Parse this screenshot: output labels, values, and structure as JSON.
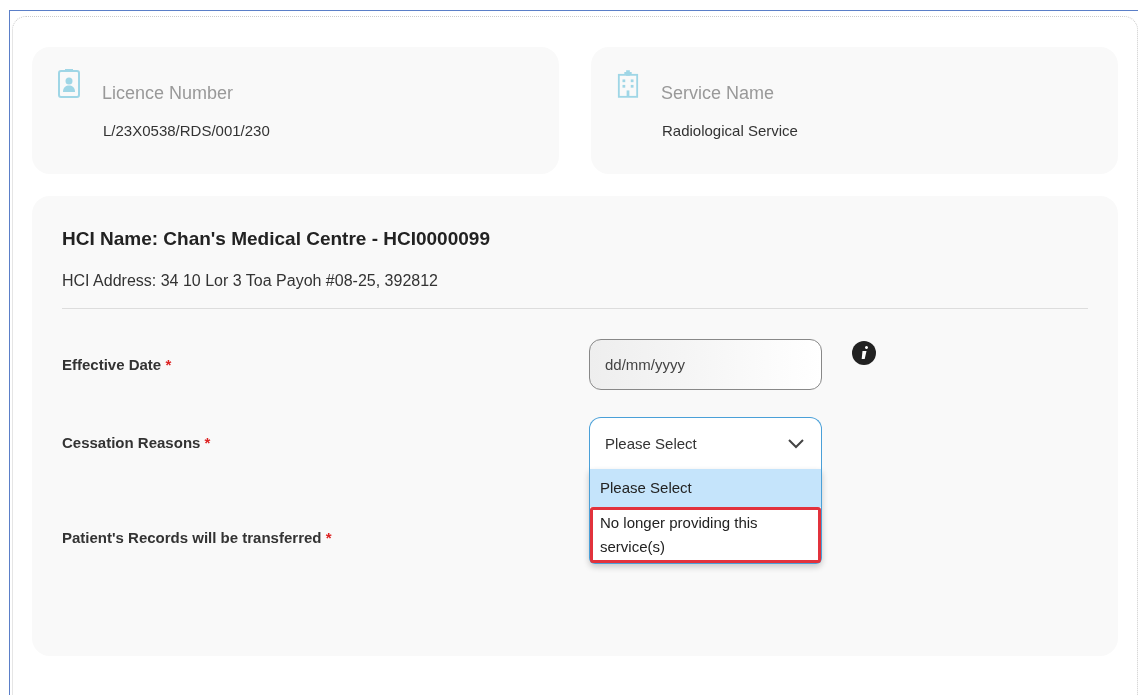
{
  "info_cards": [
    {
      "kind": "licence",
      "label": "Licence Number",
      "value": "L/23X0538/RDS/001/230"
    },
    {
      "kind": "service",
      "label": "Service Name",
      "value": "Radiological Service"
    }
  ],
  "hci": {
    "name": "HCI Name: Chan's Medical Centre - HCI0000099",
    "address": "HCI Address: 34 10 Lor 3 Toa Payoh #08-25, 392812"
  },
  "fields": [
    {
      "kind": "date",
      "label": "Effective Date",
      "required_mark": "*",
      "placeholder": "dd/mm/yyyy"
    },
    {
      "kind": "select",
      "label": "Cessation Reasons",
      "required_mark": "*",
      "value": "Please Select",
      "expanded": true,
      "options": [
        {
          "label": "Please Select",
          "selected": true,
          "highlighted": false
        },
        {
          "label": "No longer providing this service(s)",
          "selected": false,
          "highlighted": true
        }
      ]
    },
    {
      "kind": "none",
      "label": "Patient's Records will be transferred",
      "required_mark": "*"
    }
  ]
}
